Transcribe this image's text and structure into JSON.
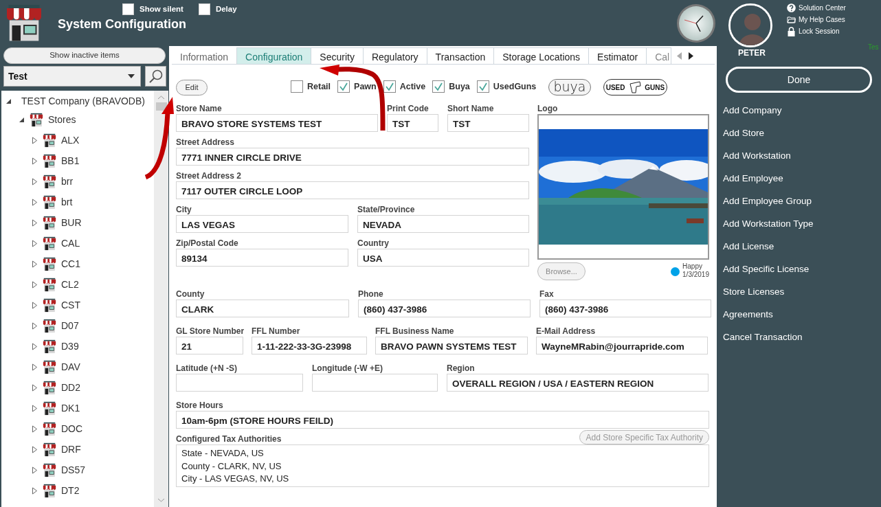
{
  "header": {
    "title": "System Configuration",
    "options": [
      {
        "label": "Show silent",
        "checked": false
      },
      {
        "label": "Delay",
        "checked": false
      }
    ],
    "user": "PETER",
    "help_links": [
      {
        "kind": "help",
        "label": "Solution Center"
      },
      {
        "kind": "folder",
        "label": "My Help Cases"
      },
      {
        "kind": "lock",
        "label": "Lock Session"
      }
    ],
    "edge_text": "Tes"
  },
  "sidebar": {
    "show_inactive_button": "Show inactive items",
    "filter": "Test",
    "tree": [
      {
        "label": "TEST Company (BRAVODB)",
        "expanded": true,
        "children": [
          {
            "label": "Stores",
            "expanded": true,
            "children": [
              {
                "label": "ALX",
                "expanded": false
              },
              {
                "label": "BB1",
                "expanded": false
              },
              {
                "label": "brr",
                "expanded": false
              },
              {
                "label": "brt",
                "expanded": false
              },
              {
                "label": "BUR",
                "expanded": false
              },
              {
                "label": "CAL",
                "expanded": false
              },
              {
                "label": "CC1",
                "expanded": false
              },
              {
                "label": "CL2",
                "expanded": false
              },
              {
                "label": "CST",
                "expanded": false
              },
              {
                "label": "D07",
                "expanded": false
              },
              {
                "label": "D39",
                "expanded": false
              },
              {
                "label": "DAV",
                "expanded": false
              },
              {
                "label": "DD2",
                "expanded": false
              },
              {
                "label": "DK1",
                "expanded": false
              },
              {
                "label": "DOC",
                "expanded": false
              },
              {
                "label": "DRF",
                "expanded": false
              },
              {
                "label": "DS57",
                "expanded": false
              },
              {
                "label": "DT2",
                "expanded": false
              }
            ]
          }
        ]
      }
    ]
  },
  "tabs": [
    {
      "label": "Information",
      "selected": false
    },
    {
      "label": "Configuration",
      "selected": true
    },
    {
      "label": "Security",
      "selected": false
    },
    {
      "label": "Regulatory",
      "selected": false
    },
    {
      "label": "Transaction",
      "selected": false
    },
    {
      "label": "Storage Locations",
      "selected": false
    },
    {
      "label": "Estimator",
      "selected": false
    },
    {
      "label": "Cal",
      "selected": false
    }
  ],
  "edit_button": "Edit",
  "flags": [
    {
      "label": "Retail",
      "checked": false
    },
    {
      "label": "Pawn",
      "checked": true
    },
    {
      "label": "Active",
      "checked": true
    },
    {
      "label": "Buya",
      "checked": true
    },
    {
      "label": "UsedGuns",
      "checked": true
    }
  ],
  "brand_badges": [
    {
      "kind": "buya",
      "text": "buya"
    },
    {
      "kind": "usedguns",
      "text": "USED",
      "text_2": "GUNS"
    }
  ],
  "top_rows": [
    [
      {
        "label": "Store Name",
        "value": "BRAVO STORE SYSTEMS TEST"
      },
      {
        "label": "Print Code",
        "value": "TST"
      },
      {
        "label": "Short Name",
        "value": "TST"
      }
    ],
    [
      {
        "label": "Street Address",
        "value": "7771 INNER CIRCLE DRIVE"
      }
    ],
    [
      {
        "label": "Street Address 2",
        "value": "7117 OUTER CIRCLE LOOP"
      }
    ],
    [
      {
        "label": "City",
        "value": "LAS VEGAS"
      },
      {
        "label": "State/Province",
        "value": "NEVADA"
      }
    ],
    [
      {
        "label": "Zip/Postal Code",
        "value": "89134"
      },
      {
        "label": "Country",
        "value": "USA"
      }
    ]
  ],
  "logo": {
    "label": "Logo",
    "browse_button": "Browse...",
    "status": {
      "label": "Happy",
      "date": "1/3/2019",
      "color": "#00a2e8"
    }
  },
  "rows": [
    [
      {
        "label": "County",
        "value": "CLARK"
      },
      {
        "label": "Phone",
        "value": "(860) 437-3986"
      },
      {
        "label": "Fax",
        "value": "(860) 437-3986"
      }
    ],
    [
      {
        "label": "GL Store Number",
        "value": "21"
      },
      {
        "label": "FFL Number",
        "value": "1-11-222-33-3G-23998"
      },
      {
        "label": "FFL Business Name",
        "value": "BRAVO PAWN SYSTEMS TEST"
      },
      {
        "label": "E-Mail Address",
        "value": "WayneMRabin@jourrapride.com"
      }
    ],
    [
      {
        "label": "Latitude (+N -S)"
      },
      {
        "label": "Longitude (-W +E)"
      },
      {
        "label": "Region",
        "value": "OVERALL REGION / USA / EASTERN REGION"
      }
    ],
    [
      {
        "label": "Store Hours",
        "value": "10am-6pm (STORE HOURS FEILD)"
      }
    ]
  ],
  "tax": {
    "label": "Configured Tax Authorities",
    "add_button": "Add Store Specific Tax Authority",
    "items": [
      "State - NEVADA, US",
      "County - CLARK, NV, US",
      "City - LAS VEGAS, NV, US"
    ]
  },
  "actions": {
    "done_button": "Done",
    "links": [
      "Add Company",
      "Add Store",
      "Add Workstation",
      "Add Employee",
      "Add Employee Group",
      "Add Workstation Type",
      "Add License",
      "Add Specific License",
      "Store Licenses",
      "Agreements",
      "Cancel Transaction"
    ]
  }
}
